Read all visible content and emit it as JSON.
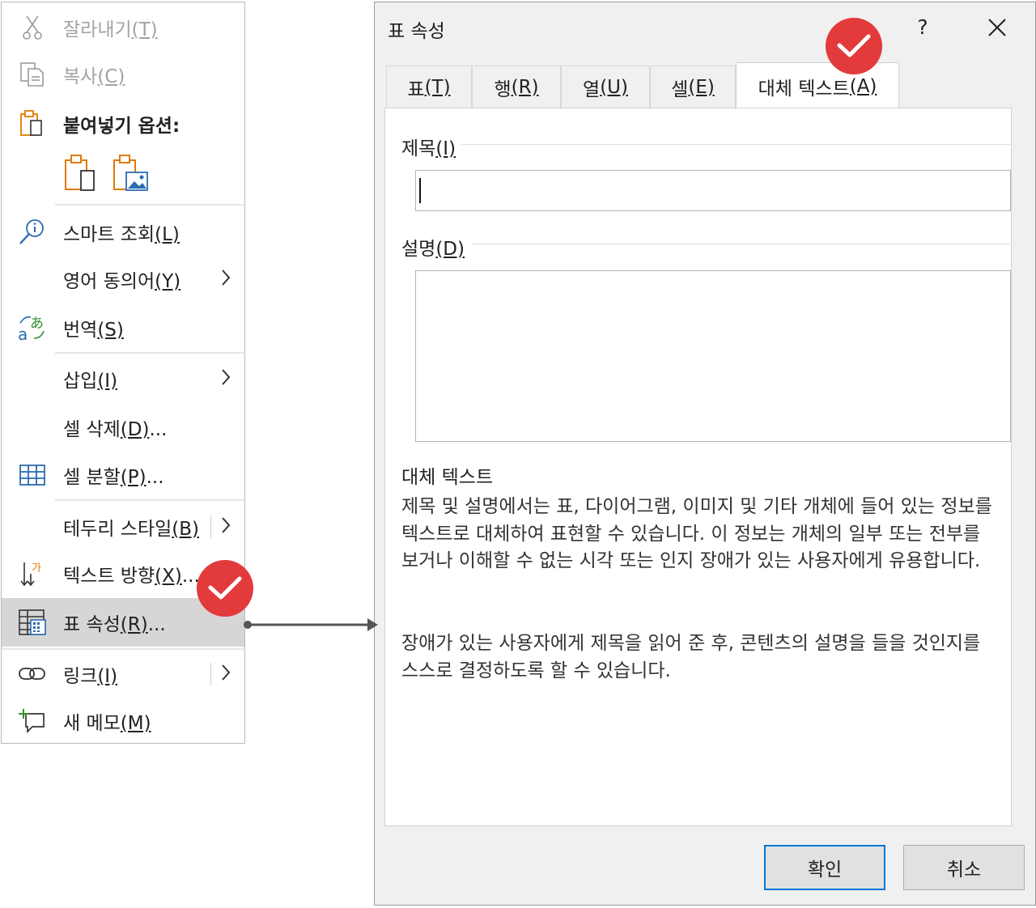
{
  "context_menu": {
    "cut": {
      "label": "잘라내기",
      "key": "(T)",
      "enabled": false
    },
    "copy": {
      "label": "복사",
      "key": "(C)",
      "enabled": false
    },
    "paste_options": {
      "label": "붙여넣기 옵션:"
    },
    "smart_lookup": {
      "label": "스마트 조회",
      "key": "(L)"
    },
    "synonyms": {
      "label": "영어 동의어",
      "key": "(Y)"
    },
    "translate": {
      "label": "번역",
      "key": "(S)"
    },
    "insert": {
      "label": "삽입",
      "key": "(I)"
    },
    "delete_cells": {
      "label": "셀 삭제",
      "key": "(D)",
      "suffix": "..."
    },
    "split_cells": {
      "label": "셀 분할",
      "key": "(P)",
      "suffix": "..."
    },
    "border_styles": {
      "label": "테두리 스타일",
      "key": "(B)"
    },
    "text_direction": {
      "label": "텍스트 방향",
      "key": "(X)",
      "suffix": "..."
    },
    "table_properties": {
      "label": "표 속성",
      "key": "(R)",
      "suffix": "...",
      "selected": true
    },
    "link": {
      "label": "링크",
      "key": "(I)"
    },
    "new_comment": {
      "label": "새 메모",
      "key": "(M)"
    }
  },
  "dialog": {
    "title": "표 속성",
    "help_label": "?",
    "tabs": [
      {
        "label": "표",
        "key": "(T)"
      },
      {
        "label": "행",
        "key": "(R)"
      },
      {
        "label": "열",
        "key": "(U)"
      },
      {
        "label": "셀",
        "key": "(E)"
      },
      {
        "label": "대체 텍스트",
        "key": "(A)",
        "active": true
      }
    ],
    "title_field": {
      "label": "제목",
      "key": "(I)",
      "value": ""
    },
    "description_field": {
      "label": "설명",
      "key": "(D)",
      "value": ""
    },
    "help_heading": "대체 텍스트",
    "help_paragraph_1": "제목 및 설명에서는 표, 다이어그램, 이미지 및 기타 개체에 들어 있는 정보를 텍스트로 대체하여 표현할 수 있습니다. 이 정보는 개체의 일부 또는 전부를 보거나 이해할 수 없는 시각 또는 인지 장애가 있는 사용자에게 유용합니다.",
    "help_paragraph_2": "장애가 있는 사용자에게 제목을 읽어 준 후, 콘텐츠의 설명을 들을 것인지를 스스로 결정하도록 할 수 있습니다.",
    "ok_label": "확인",
    "cancel_label": "취소"
  },
  "colors": {
    "badge": "#e33a3c",
    "selected_row": "#d6d6d6",
    "default_button_border": "#0078d7",
    "icon_orange": "#e07b00",
    "icon_blue": "#2b6cb0"
  }
}
